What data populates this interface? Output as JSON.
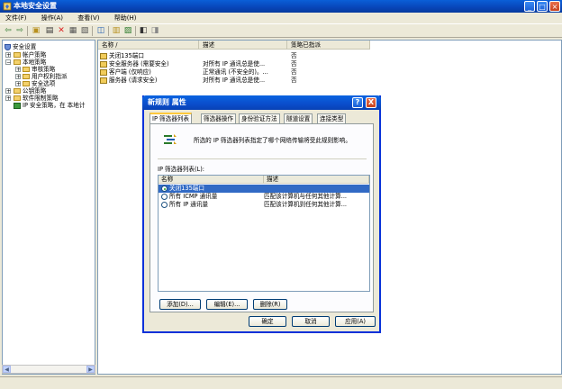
{
  "window": {
    "title": "本地安全设置"
  },
  "menu": [
    "文件(F)",
    "操作(A)",
    "查看(V)",
    "帮助(H)"
  ],
  "tree": [
    {
      "label": "安全设置"
    },
    {
      "label": "帐户策略"
    },
    {
      "label": "本地策略"
    },
    {
      "label": "审核策略"
    },
    {
      "label": "用户权利指派"
    },
    {
      "label": "安全选项"
    },
    {
      "label": "公钥策略"
    },
    {
      "label": "软件限制策略"
    },
    {
      "label": "IP 安全策略，在 本地计"
    }
  ],
  "list": {
    "headers": {
      "name": "名称 /",
      "desc": "描述",
      "assigned": "策略已指派"
    },
    "rows": [
      {
        "name": "关闭135端口",
        "desc": "",
        "assigned": "否"
      },
      {
        "name": "安全服务器 (需要安全)",
        "desc": "对所有 IP 通讯总是使...",
        "assigned": "否"
      },
      {
        "name": "客户端 (仅响应)",
        "desc": "正常通讯 (不安全的)。...",
        "assigned": "否"
      },
      {
        "name": "服务器 (请求安全)",
        "desc": "对所有 IP 通讯总是使...",
        "assigned": "否"
      }
    ]
  },
  "dialog": {
    "title": "新规则 属性",
    "help": "?",
    "close": "X",
    "tabs": [
      "IP 筛选器列表",
      "筛选器操作",
      "身份验证方法",
      "隧道设置",
      "连接类型"
    ],
    "description": "所选的 IP 筛选器列表指定了哪个网络传输将受此规则影响。",
    "list_label": "IP 筛选器列表(L):",
    "headers": {
      "name": "名称",
      "desc": "描述"
    },
    "rows": [
      {
        "name": "关闭135端口",
        "desc": ""
      },
      {
        "name": "所有 ICMP 通讯量",
        "desc": "匹配该计算机与任何其他计算..."
      },
      {
        "name": "所有 IP 通讯量",
        "desc": "匹配该计算机到任何其他计算..."
      }
    ],
    "selected_index": 0,
    "buttons": {
      "add": "添加(D)...",
      "edit": "编辑(E)...",
      "remove": "删除(R)"
    },
    "footer": {
      "ok": "确定",
      "cancel": "取消",
      "apply": "应用(A)"
    }
  }
}
